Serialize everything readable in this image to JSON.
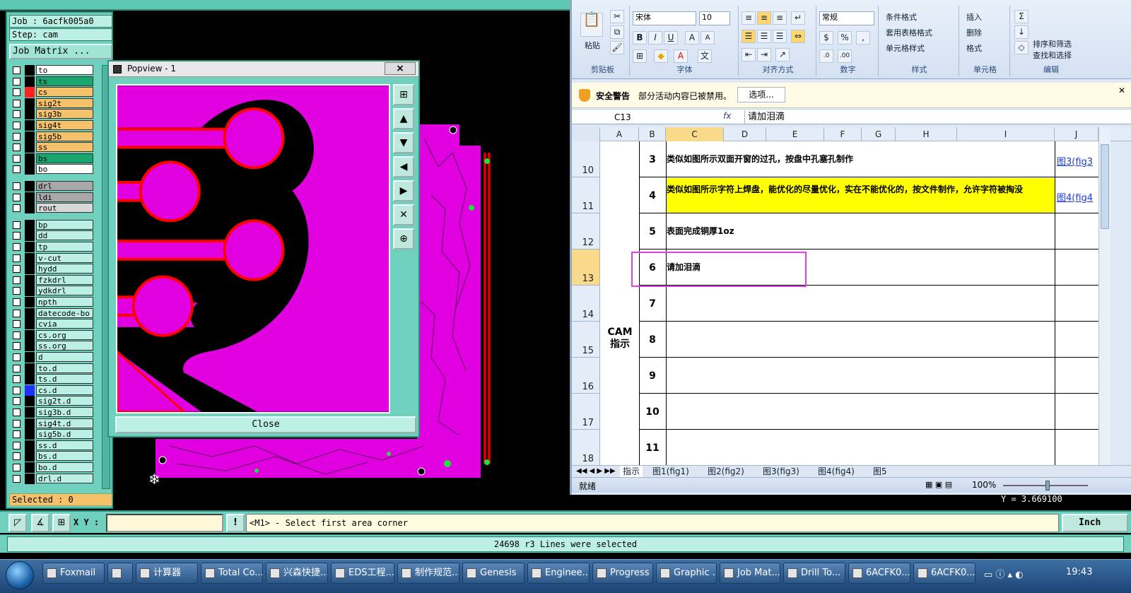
{
  "genesis": {
    "job_label": "Job : 6acfk005a0",
    "step_label": "Step: cam",
    "job_matrix_label": "Job Matrix ...",
    "selected_label": "Selected : 0",
    "layers": [
      {
        "name": "to",
        "bg": "#ffffff",
        "color": "#000000"
      },
      {
        "name": "ts",
        "bg": "#1aa66f",
        "color": "#000000"
      },
      {
        "name": "cs",
        "bg": "#f5c26b",
        "color": "#ff2020"
      },
      {
        "name": "sig2t",
        "bg": "#f5c26b",
        "color": "#000000"
      },
      {
        "name": "sig3b",
        "bg": "#f5c26b",
        "color": "#000000"
      },
      {
        "name": "sig4t",
        "bg": "#f5c26b",
        "color": "#000000"
      },
      {
        "name": "sig5b",
        "bg": "#f5c26b",
        "color": "#000000"
      },
      {
        "name": "ss",
        "bg": "#f5c26b",
        "color": "#000000"
      },
      {
        "name": "bs",
        "bg": "#1aa66f",
        "color": "#000000"
      },
      {
        "name": "bo",
        "bg": "#ffffff",
        "color": "#000000"
      },
      {
        "name": "drl",
        "bg": "#a8a8a8",
        "color": "#000000"
      },
      {
        "name": "ldi",
        "bg": "#a8a8a8",
        "color": "#000000"
      },
      {
        "name": "rout",
        "bg": "#d8d8d8",
        "color": "#000000"
      },
      {
        "name": "bp",
        "bg": "#bdf0e4",
        "color": "#000000"
      },
      {
        "name": "dd",
        "bg": "#bdf0e4",
        "color": "#000000"
      },
      {
        "name": "tp",
        "bg": "#bdf0e4",
        "color": "#000000"
      },
      {
        "name": "v-cut",
        "bg": "#bdf0e4",
        "color": "#000000"
      },
      {
        "name": "hydd",
        "bg": "#bdf0e4",
        "color": "#000000"
      },
      {
        "name": "fzkdrl",
        "bg": "#bdf0e4",
        "color": "#000000"
      },
      {
        "name": "ydkdrl",
        "bg": "#bdf0e4",
        "color": "#000000"
      },
      {
        "name": "npth",
        "bg": "#bdf0e4",
        "color": "#000000"
      },
      {
        "name": "datecode-bo",
        "bg": "#bdf0e4",
        "color": "#000000"
      },
      {
        "name": "cvia",
        "bg": "#bdf0e4",
        "color": "#000000"
      },
      {
        "name": "cs.org",
        "bg": "#bdf0e4",
        "color": "#000000"
      },
      {
        "name": "ss.org",
        "bg": "#bdf0e4",
        "color": "#000000"
      },
      {
        "name": "d",
        "bg": "#bdf0e4",
        "color": "#000000"
      },
      {
        "name": "to.d",
        "bg": "#bdf0e4",
        "color": "#000000"
      },
      {
        "name": "ts.d",
        "bg": "#bdf0e4",
        "color": "#000000"
      },
      {
        "name": "cs.d",
        "bg": "#bdf0e4",
        "color": "#2030ff"
      },
      {
        "name": "sig2t.d",
        "bg": "#bdf0e4",
        "color": "#000000"
      },
      {
        "name": "sig3b.d",
        "bg": "#bdf0e4",
        "color": "#000000"
      },
      {
        "name": "sig4t.d",
        "bg": "#bdf0e4",
        "color": "#000000"
      },
      {
        "name": "sig5b.d",
        "bg": "#bdf0e4",
        "color": "#000000"
      },
      {
        "name": "ss.d",
        "bg": "#bdf0e4",
        "color": "#000000"
      },
      {
        "name": "bs.d",
        "bg": "#bdf0e4",
        "color": "#000000"
      },
      {
        "name": "bo.d",
        "bg": "#bdf0e4",
        "color": "#000000"
      },
      {
        "name": "drl.d",
        "bg": "#bdf0e4",
        "color": "#000000"
      }
    ],
    "popview": {
      "title": "Popview - 1",
      "close_x": "×",
      "close_label": "Close"
    },
    "xy_label": "X Y :",
    "prompt_text": "<M1> - Select first area corner",
    "unit_label": "Inch",
    "y_readout": "Y = 3.669100",
    "message": "24698 r3 Lines were selected"
  },
  "excel": {
    "font_name": "宋体",
    "font_size": "10",
    "number_format": "常规",
    "paste_label": "粘贴",
    "group_labels": [
      "剪贴板",
      "字体",
      "对齐方式",
      "数字",
      "样式",
      "单元格",
      "编辑"
    ],
    "styles_items": [
      "条件格式",
      "套用表格格式",
      "单元格样式"
    ],
    "cells_items": [
      "插入",
      "删除",
      "格式"
    ],
    "edit_items": [
      "排序和筛选",
      "查找和选择"
    ],
    "security_title": "安全警告",
    "security_text": "部分活动内容已被禁用。",
    "security_button": "选项...",
    "name_box": "C13",
    "fx_label": "fx",
    "formula_text": "请加泪滴",
    "columns": [
      "A",
      "B",
      "C",
      "D",
      "E",
      "F",
      "G",
      "H",
      "I",
      "J"
    ],
    "row_headers": [
      "10",
      "11",
      "12",
      "13",
      "14",
      "15",
      "16",
      "17",
      "18"
    ],
    "rows": [
      {
        "no": "3",
        "text": "类似如图所示双面开窗的过孔，按盘中孔塞孔制作",
        "link": "图3(fig3"
      },
      {
        "no": "4",
        "text": "类似如图所示字符上焊盘，能优化的尽量优化，实在不能优化的，按文件制作，允许字符被掏没",
        "link": "图4(fig4"
      },
      {
        "no": "5",
        "text": "表面完成铜厚1oz",
        "link": ""
      },
      {
        "no": "6",
        "text": "请加泪滴",
        "link": ""
      },
      {
        "no": "7",
        "text": "",
        "link": ""
      },
      {
        "no": "8",
        "text": "",
        "link": ""
      },
      {
        "no": "9",
        "text": "",
        "link": ""
      },
      {
        "no": "10",
        "text": "",
        "link": ""
      },
      {
        "no": "11",
        "text": "",
        "link": ""
      }
    ],
    "section_label": "CAM\n指示",
    "sheet_tabs": [
      "指示",
      "图1(fig1)",
      "图2(fig2)",
      "图3(fig3)",
      "图4(fig4)",
      "图5"
    ],
    "status_ready": "就绪",
    "zoom": "100%"
  },
  "taskbar": {
    "items": [
      "Foxmail",
      "",
      "计算器",
      "Total Co...",
      "兴森快捷...",
      "EDS工程...",
      "制作规范...",
      "Genesis",
      "Enginee...",
      "Progress",
      "Graphic ...",
      "Job Mat...",
      "Drill To...",
      "6ACFK0...",
      "6ACFK0..."
    ],
    "clock": "19:43"
  }
}
